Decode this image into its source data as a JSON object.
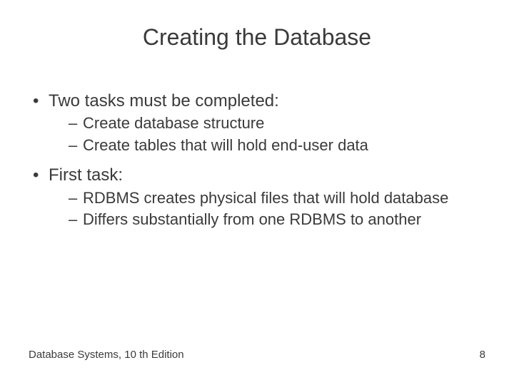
{
  "title": "Creating the Database",
  "bullets": {
    "b1": "Two tasks must be completed:",
    "b1a": "Create database structure",
    "b1b": "Create tables that will hold end-user data",
    "b2": "First task:",
    "b2a": "RDBMS creates physical files that will hold database",
    "b2b": "Differs substantially from one RDBMS to another"
  },
  "footer": {
    "left": "Database Systems, 10 th Edition",
    "right": "8"
  }
}
